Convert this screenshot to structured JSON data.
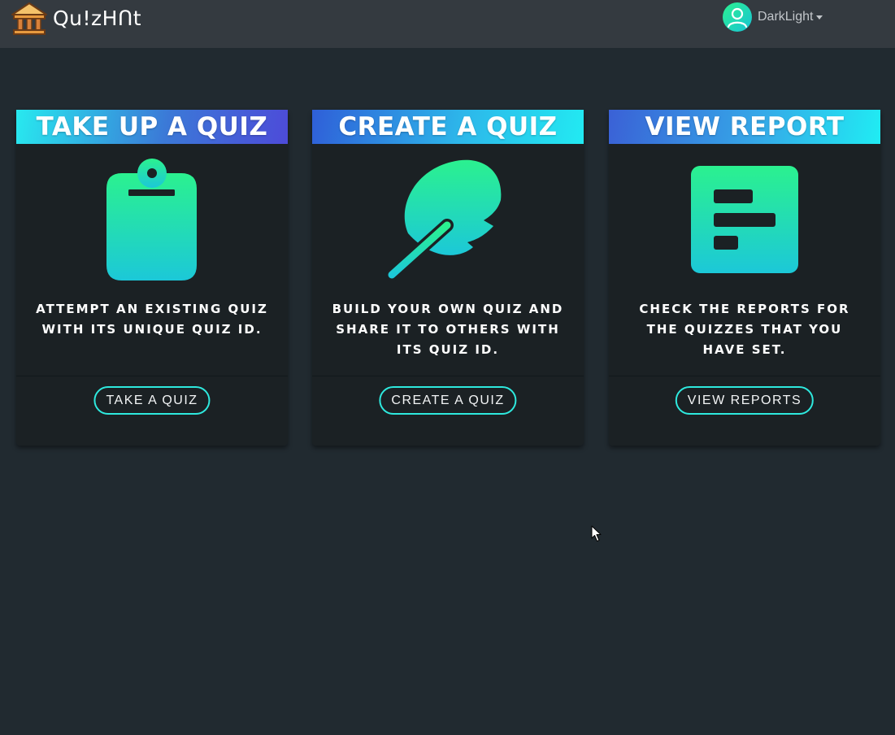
{
  "brand": {
    "name": "Qu!zHᑎt",
    "logo_icon": "temple-icon"
  },
  "user": {
    "name": "DarkLight",
    "avatar_icon": "user-avatar-icon"
  },
  "cards": [
    {
      "title": "TAKE UP A QUIZ",
      "icon": "clipboard-icon",
      "description": "ATTEMPT AN EXISTING QUIZ WITH ITS UNIQUE QUIZ ID.",
      "button_label": "TAKE A QUIZ"
    },
    {
      "title": "CREATE A QUIZ",
      "icon": "feather-icon",
      "description": "BUILD YOUR OWN QUIZ AND SHARE IT TO OTHERS WITH ITS QUIZ ID.",
      "button_label": "CREATE A QUIZ"
    },
    {
      "title": "VIEW REPORT",
      "icon": "report-icon",
      "description": "CHECK THE REPORTS FOR THE QUIZZES THAT YOU HAVE SET.",
      "button_label": "VIEW REPORTS"
    }
  ],
  "colors": {
    "background": "#212a30",
    "navbar": "#343a40",
    "card": "#1b2124",
    "accent": "#2ee9de",
    "icon_gradient_top": "#2bf18f",
    "icon_gradient_bottom": "#1cc8d8"
  }
}
